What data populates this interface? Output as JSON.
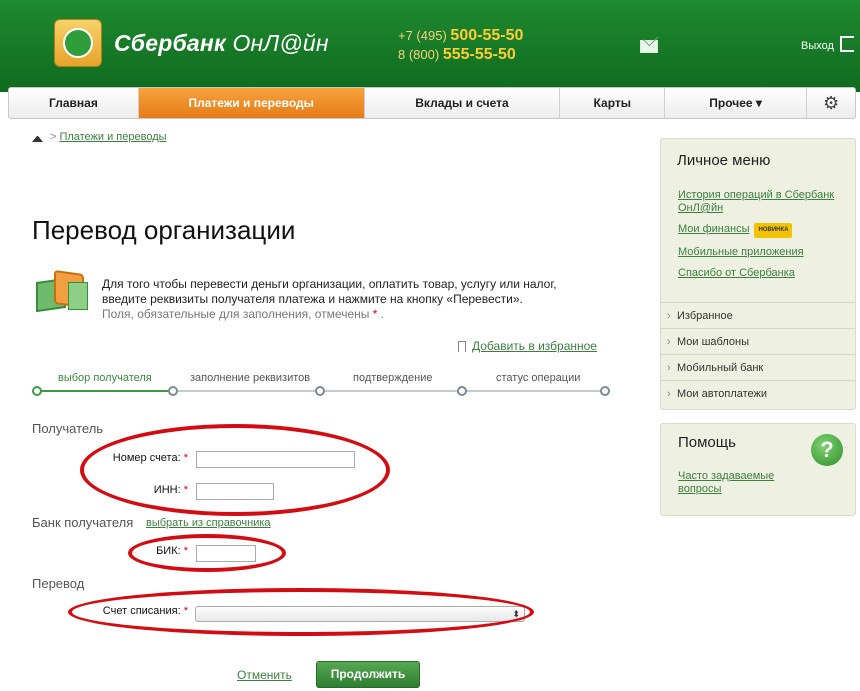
{
  "header": {
    "brand_bold": "Сбербанк",
    "brand_light": "ОнЛ@йн",
    "phone1_prefix": "+7 (495)",
    "phone1_number": "500-55-50",
    "phone2_prefix": "8 (800)",
    "phone2_number": "555-55-50",
    "exit_label": "Выход",
    "icons": [
      "logo-icon",
      "mail-icon",
      "exit-icon"
    ]
  },
  "nav": {
    "items": [
      "Главная",
      "Платежи и переводы",
      "Вклады и счета",
      "Карты",
      "Прочее ▾"
    ],
    "active_index": 1,
    "active_color": "#e57c16",
    "settings_icon": "gear-icon"
  },
  "breadcrumb": {
    "home_icon": "home-icon",
    "separator": ">",
    "link": "Платежи и переводы"
  },
  "page": {
    "title": "Перевод организации",
    "intro_text": "Для того чтобы перевести деньги организации, оплатить товар, услугу или налог, введите реквизиты получателя платежа и нажмите на кнопку «Перевести».",
    "required_note": "Поля, обязательные для заполнения, отмечены",
    "required_mark": "*",
    "required_note_end": ".",
    "favorite_link": "Добавить в избранное"
  },
  "steps": {
    "items": [
      "выбор получателя",
      "заполнение реквизитов",
      "подтверждение",
      "статус операции"
    ],
    "current_index": 0
  },
  "form": {
    "recipient_section": "Получатель",
    "account_label": "Номер счета:",
    "account_value": "",
    "inn_label": "ИНН:",
    "inn_value": "",
    "bank_section": "Банк получателя",
    "bank_ref_link": "выбрать из справочника",
    "bik_label": "БИК:",
    "bik_value": "",
    "transfer_section": "Перевод",
    "debit_label": "Счет списания:",
    "debit_value": "",
    "select_arrow": "⬍",
    "required_mark": "*",
    "cancel_label": "Отменить",
    "continue_label": "Продолжить",
    "highlight_color": "#d40c12"
  },
  "sidebar": {
    "menu_title": "Личное меню",
    "links": [
      "История операций в Сбербанк ОнЛ@йн",
      "Мои финансы",
      "Мобильные приложения",
      "Спасибо от Сбербанка"
    ],
    "new_badge": "НОВИНКА",
    "items": [
      "Избранное",
      "Мои шаблоны",
      "Мобильный банк",
      "Мои автоплатежи"
    ],
    "help_title": "Помощь",
    "help_link": "Часто задаваемые вопросы",
    "help_icon": "question-icon",
    "help_glyph": "?"
  }
}
